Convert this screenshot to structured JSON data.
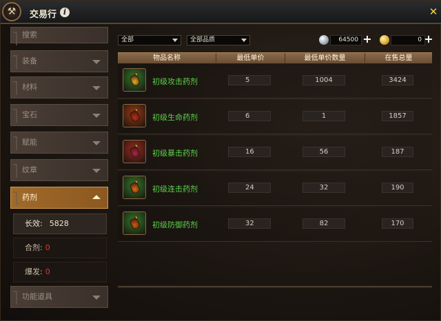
{
  "window": {
    "title": "交易行",
    "logo_glyph": "⚒",
    "info_glyph": "i",
    "close_glyph": "✕"
  },
  "sidebar": {
    "categories": [
      {
        "label": "搜索"
      },
      {
        "label": "装备"
      },
      {
        "label": "材料"
      },
      {
        "label": "宝石"
      },
      {
        "label": "赋能"
      },
      {
        "label": "纹章"
      },
      {
        "label": "药剂",
        "expanded": true
      },
      {
        "label": "功能道具"
      }
    ],
    "subcategories": [
      {
        "label": "长效:",
        "count": "5828",
        "selected": true
      },
      {
        "label": "合剂:",
        "count": "0"
      },
      {
        "label": "爆发:",
        "count": "0"
      }
    ]
  },
  "filters": {
    "type_select": "全部",
    "quality_select": "全部品质"
  },
  "currency": {
    "silver_amount": "64500",
    "gold_amount": "0",
    "plus_glyph": "+"
  },
  "table": {
    "headers": [
      "物品名称",
      "最低单价",
      "最低单价数量",
      "在售总量"
    ],
    "rows": [
      {
        "name": "初级攻击药剂",
        "price": "5",
        "min_qty": "1004",
        "total": "3424",
        "liquid": "#e8b020",
        "icon_bg": "#2f7a2a"
      },
      {
        "name": "初级生命药剂",
        "price": "6",
        "min_qty": "1",
        "total": "1857",
        "liquid": "#c02a1a",
        "icon_bg": "#9a3a14"
      },
      {
        "name": "初级暴击药剂",
        "price": "16",
        "min_qty": "56",
        "total": "187",
        "liquid": "#b0204a",
        "icon_bg": "#9a2a20"
      },
      {
        "name": "初级连击药剂",
        "price": "24",
        "min_qty": "32",
        "total": "190",
        "liquid": "#e06a1a",
        "icon_bg": "#2f7a2a"
      },
      {
        "name": "初级防御药剂",
        "price": "32",
        "min_qty": "82",
        "total": "170",
        "liquid": "#d05a14",
        "icon_bg": "#2f7a2a"
      }
    ]
  },
  "colors": {
    "accent_gold": "#f5d24a",
    "item_name_green": "#5ad24a",
    "zero_count_red": "#e03a2a",
    "active_tab": "#a06a2a"
  }
}
